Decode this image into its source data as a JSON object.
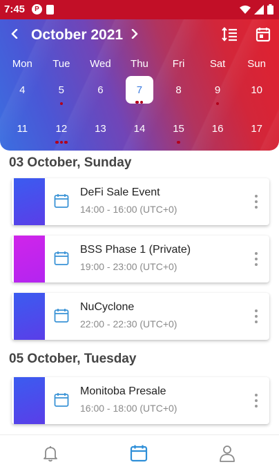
{
  "status_bar": {
    "time": "7:45",
    "left_icons": [
      "p-badge-icon",
      "sd-card-icon"
    ],
    "right_icons": [
      "wifi-icon",
      "signal-icon",
      "battery-icon"
    ]
  },
  "header": {
    "month": "October 2021",
    "prev_icon": "chevron-left-icon",
    "next_icon": "chevron-right-icon",
    "actions": [
      "sort-icon",
      "calendar-today-icon"
    ],
    "weekdays": [
      "Mon",
      "Tue",
      "Wed",
      "Thu",
      "Fri",
      "Sat",
      "Sun"
    ],
    "weeks": [
      [
        {
          "day": "4",
          "dots": 0
        },
        {
          "day": "5",
          "dots": 1
        },
        {
          "day": "6",
          "dots": 0
        },
        {
          "day": "7",
          "dots": 2,
          "selected": true
        },
        {
          "day": "8",
          "dots": 0
        },
        {
          "day": "9",
          "dots": 1
        },
        {
          "day": "10",
          "dots": 0
        }
      ],
      [
        {
          "day": "11",
          "dots": 0
        },
        {
          "day": "12",
          "dots": 3
        },
        {
          "day": "13",
          "dots": 0
        },
        {
          "day": "14",
          "dots": 0
        },
        {
          "day": "15",
          "dots": 1
        },
        {
          "day": "16",
          "dots": 0
        },
        {
          "day": "17",
          "dots": 0
        }
      ]
    ]
  },
  "sections": [
    {
      "title": "03 October,  Sunday",
      "events": [
        {
          "title": "DeFi Sale Event",
          "time": "14:00 - 16:00 (UTC+0)",
          "color": "#4a4ff0"
        },
        {
          "title": "BSS Phase 1 (Private)",
          "time": "19:00 - 23:00 (UTC+0)",
          "color": "#c824ef"
        },
        {
          "title": "NuCyclone",
          "time": "22:00 - 22:30 (UTC+0)",
          "color": "#4a4ff0"
        }
      ]
    },
    {
      "title": "05 October,  Tuesday",
      "events": [
        {
          "title": "Monitoba Presale",
          "time": "16:00 - 18:00 (UTC+0)",
          "color": "#4a4ff0"
        }
      ]
    }
  ],
  "bottom_nav": {
    "items": [
      "bell-icon",
      "calendar-icon",
      "user-icon"
    ],
    "active": "calendar-icon",
    "active_color": "#2f8fd8",
    "inactive_color": "#8a8a8a"
  },
  "colors": {
    "status_bar": "#c20f27",
    "event_dot": "#b2001a",
    "selected_day_text": "#3d7de0",
    "event_icon": "#3a93d6"
  }
}
